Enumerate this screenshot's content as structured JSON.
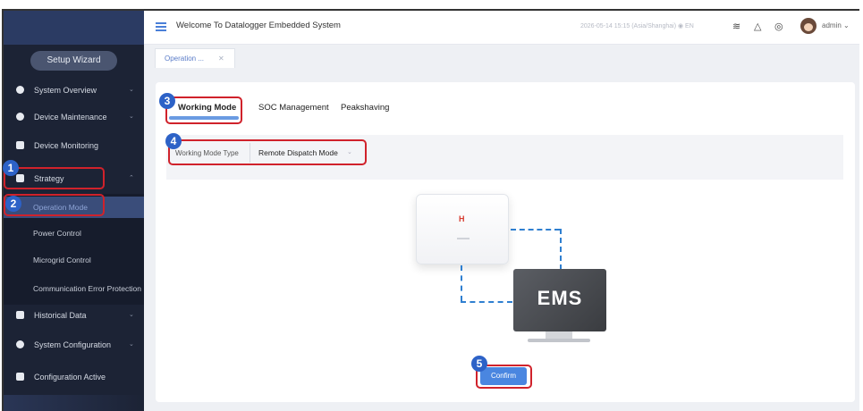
{
  "header": {
    "title": "Welcome To Datalogger Embedded System",
    "datetime": "2026-05-14 15:15 (Asia/Shanghai)",
    "language": "EN",
    "user": "admin"
  },
  "sidebar": {
    "wizard_label": "Setup Wizard",
    "items": [
      {
        "label": "System Overview",
        "icon": "pie-chart-icon"
      },
      {
        "label": "Device Maintenance",
        "icon": "gear-icon"
      },
      {
        "label": "Device Monitoring",
        "icon": "monitor-icon"
      },
      {
        "label": "Strategy",
        "icon": "strategy-icon"
      },
      {
        "label": "Historical Data",
        "icon": "history-icon"
      },
      {
        "label": "System Configuration",
        "icon": "config-icon"
      },
      {
        "label": "Configuration Active",
        "icon": "activate-icon"
      }
    ],
    "strategy_sub": [
      {
        "label": "Operation Mode"
      },
      {
        "label": "Power Control"
      },
      {
        "label": "Microgrid Control"
      },
      {
        "label": "Communication Error Protection"
      }
    ]
  },
  "tabs": [
    {
      "label": "Operation ..."
    }
  ],
  "subtabs": [
    {
      "label": "Working Mode"
    },
    {
      "label": "SOC Management"
    },
    {
      "label": "Peakshaving"
    }
  ],
  "form": {
    "label": "Working Mode Type",
    "value": "Remote Dispatch Mode"
  },
  "diagram": {
    "inverter_logo": "H",
    "ems_label": "EMS"
  },
  "confirm_label": "Confirm",
  "steps": [
    "1",
    "2",
    "3",
    "4",
    "5"
  ],
  "colors": {
    "sidebar": "#1c2335",
    "accent": "#4a86e0",
    "highlight": "#d0222b",
    "badge": "#2d62c7"
  }
}
